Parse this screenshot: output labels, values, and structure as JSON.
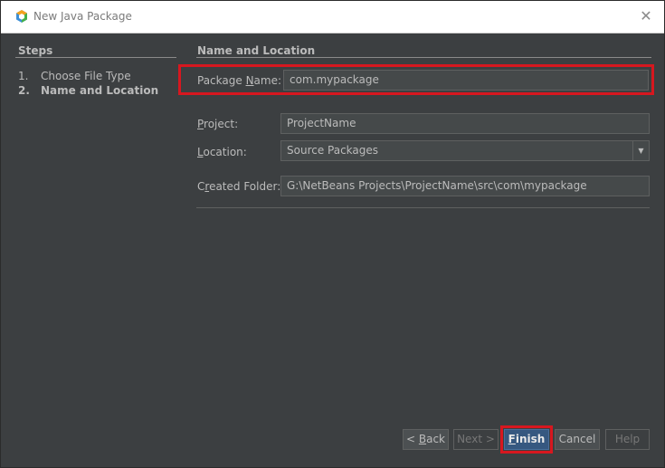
{
  "window": {
    "title": "New Java Package",
    "close_glyph": "✕"
  },
  "steps": {
    "title": "Steps",
    "items": [
      {
        "num": "1.",
        "label": "Choose File Type"
      },
      {
        "num": "2.",
        "label": "Name and Location"
      }
    ]
  },
  "section": {
    "title": "Name and Location"
  },
  "form": {
    "package_name": {
      "label_before": "Package ",
      "label_mnemonic": "N",
      "label_after": "ame:",
      "value": "com.mypackage"
    },
    "project": {
      "label_mnemonic": "P",
      "label_after": "roject:",
      "value": "ProjectName"
    },
    "location": {
      "label_mnemonic": "L",
      "label_after": "ocation:",
      "value": "Source Packages"
    },
    "created_folder": {
      "label_before": "C",
      "label_mnemonic": "r",
      "label_after": "eated Folder:",
      "value": "G:\\NetBeans Projects\\ProjectName\\src\\com\\mypackage"
    }
  },
  "buttons": {
    "back": {
      "prefix": "< ",
      "mnemonic": "B",
      "rest": "ack"
    },
    "next": "Next >",
    "finish": {
      "mnemonic": "F",
      "rest": "inish"
    },
    "cancel": "Cancel",
    "help": "Help"
  },
  "colors": {
    "highlight": "#d7171f",
    "background": "#3c3f41",
    "primary_button": "#365880"
  },
  "icons": {
    "app": "netbeans-logo-icon",
    "close": "close-icon",
    "dropdown": "chevron-down-icon"
  }
}
